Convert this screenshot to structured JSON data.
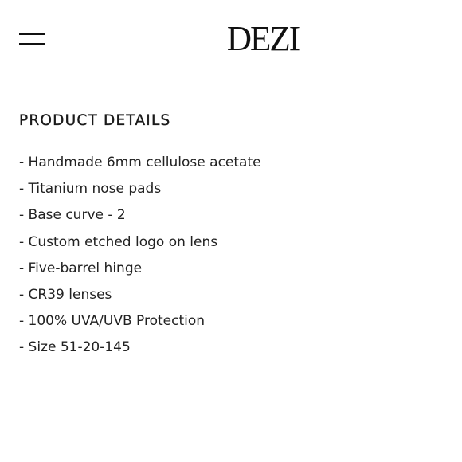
{
  "header": {
    "menu_icon": "hamburger-menu-icon",
    "logo_text": "DEZI"
  },
  "product_details": {
    "title": "PRODUCT DETAILS",
    "items": [
      "- Handmade 6mm cellulose acetate",
      "- Titanium nose pads",
      "- Base curve - 2",
      "- Custom etched logo on lens",
      "- Five-barrel hinge",
      "- CR39 lenses",
      "- 100% UVA/UVB Protection",
      "- Size 51-20-145"
    ]
  },
  "colors": {
    "background": "#ffffff",
    "text": "#1a1a1a"
  }
}
